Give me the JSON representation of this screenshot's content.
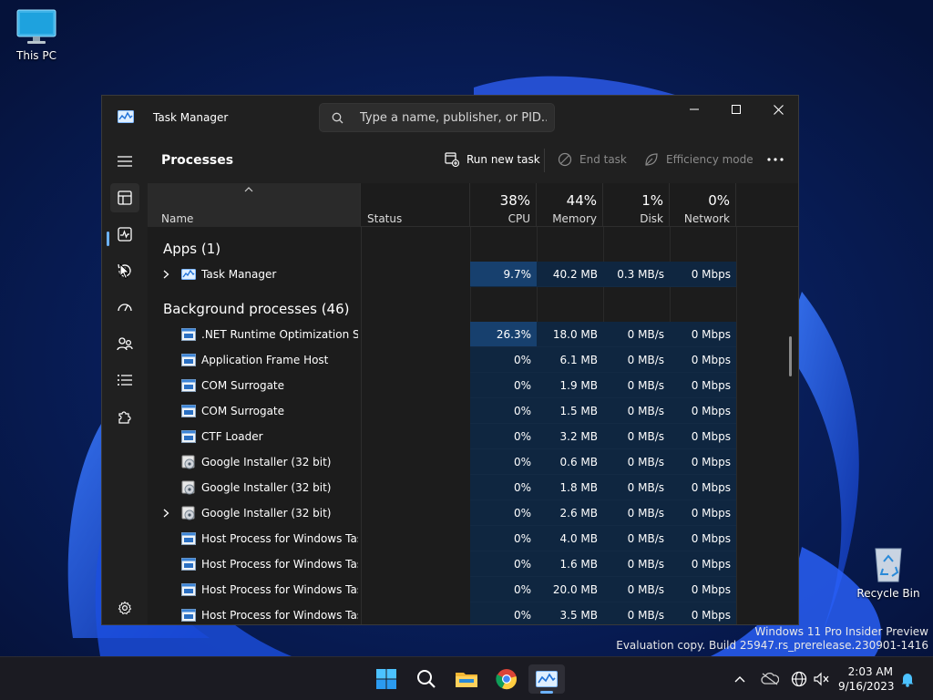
{
  "desktop": {
    "this_pc_label": "This PC",
    "recycle_bin_label": "Recycle Bin",
    "watermark_line1": "Windows 11 Pro Insider Preview",
    "watermark_line2": "Evaluation copy. Build 25947.rs_prerelease.230901-1416"
  },
  "window": {
    "title": "Task Manager",
    "search_placeholder": "Type a name, publisher, or PID..."
  },
  "toolbar": {
    "page_title": "Processes",
    "run_new_task": "Run new task",
    "end_task": "End task",
    "efficiency_mode": "Efficiency mode"
  },
  "columns": {
    "name": "Name",
    "status": "Status",
    "cpu_pct": "38%",
    "cpu": "CPU",
    "memory_pct": "44%",
    "memory": "Memory",
    "disk_pct": "1%",
    "disk": "Disk",
    "network_pct": "0%",
    "network": "Network"
  },
  "groups": {
    "apps": "Apps (1)",
    "background": "Background processes (46)"
  },
  "apps": [
    {
      "name": "Task Manager",
      "cpu": "9.7%",
      "memory": "40.2 MB",
      "disk": "0.3 MB/s",
      "network": "0 Mbps",
      "expandable": true,
      "icon": "task-manager-icon"
    }
  ],
  "background": [
    {
      "name": ".NET Runtime Optimization Se...",
      "cpu": "26.3%",
      "memory": "18.0 MB",
      "disk": "0 MB/s",
      "network": "0 Mbps",
      "icon": "window-app-icon"
    },
    {
      "name": "Application Frame Host",
      "cpu": "0%",
      "memory": "6.1 MB",
      "disk": "0 MB/s",
      "network": "0 Mbps",
      "icon": "window-app-icon"
    },
    {
      "name": "COM Surrogate",
      "cpu": "0%",
      "memory": "1.9 MB",
      "disk": "0 MB/s",
      "network": "0 Mbps",
      "icon": "window-app-icon"
    },
    {
      "name": "COM Surrogate",
      "cpu": "0%",
      "memory": "1.5 MB",
      "disk": "0 MB/s",
      "network": "0 Mbps",
      "icon": "window-app-icon"
    },
    {
      "name": "CTF Loader",
      "cpu": "0%",
      "memory": "3.2 MB",
      "disk": "0 MB/s",
      "network": "0 Mbps",
      "icon": "window-app-icon"
    },
    {
      "name": "Google Installer (32 bit)",
      "cpu": "0%",
      "memory": "0.6 MB",
      "disk": "0 MB/s",
      "network": "0 Mbps",
      "icon": "installer-icon"
    },
    {
      "name": "Google Installer (32 bit)",
      "cpu": "0%",
      "memory": "1.8 MB",
      "disk": "0 MB/s",
      "network": "0 Mbps",
      "icon": "installer-icon"
    },
    {
      "name": "Google Installer (32 bit)",
      "cpu": "0%",
      "memory": "2.6 MB",
      "disk": "0 MB/s",
      "network": "0 Mbps",
      "icon": "installer-icon",
      "expandable": true
    },
    {
      "name": "Host Process for Windows Tasks",
      "cpu": "0%",
      "memory": "4.0 MB",
      "disk": "0 MB/s",
      "network": "0 Mbps",
      "icon": "window-app-icon"
    },
    {
      "name": "Host Process for Windows Tasks",
      "cpu": "0%",
      "memory": "1.6 MB",
      "disk": "0 MB/s",
      "network": "0 Mbps",
      "icon": "window-app-icon"
    },
    {
      "name": "Host Process for Windows Tasks",
      "cpu": "0%",
      "memory": "20.0 MB",
      "disk": "0 MB/s",
      "network": "0 Mbps",
      "icon": "window-app-icon"
    },
    {
      "name": "Host Process for Windows Tasks",
      "cpu": "0%",
      "memory": "3.5 MB",
      "disk": "0 MB/s",
      "network": "0 Mbps",
      "icon": "window-app-icon"
    }
  ],
  "taskbar": {
    "time": "2:03 AM",
    "date": "9/16/2023"
  },
  "colors": {
    "accent": "#6cb2ff",
    "cell_bg": "#0f2640",
    "cell_hot": "#17406e"
  }
}
